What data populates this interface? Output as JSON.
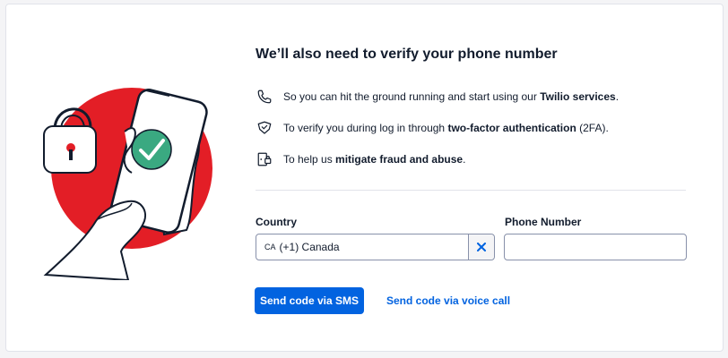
{
  "title": "We’ll also need to verify your phone number",
  "benefits": [
    {
      "icon": "phone-icon",
      "text_plain": "So you can hit the ground running and start using our ",
      "text_bold": "Twilio services",
      "text_end": "."
    },
    {
      "icon": "shield-check-icon",
      "text_plain": "To verify you during log in through ",
      "text_bold": "two-factor authentication",
      "text_end": " (2FA)."
    },
    {
      "icon": "door-lock-icon",
      "text_plain": "To help us ",
      "text_bold": "mitigate fraud and abuse",
      "text_end": "."
    }
  ],
  "form": {
    "country_label": "Country",
    "country_flag": "CA",
    "country_value": "(+1) Canada",
    "phone_label": "Phone Number",
    "phone_value": ""
  },
  "buttons": {
    "sms_label": "Send code via SMS",
    "voice_label": "Send code via voice call"
  },
  "colors": {
    "primary": "#0263e0",
    "illustration_red": "#e31e26",
    "check_green": "#3aa981"
  }
}
